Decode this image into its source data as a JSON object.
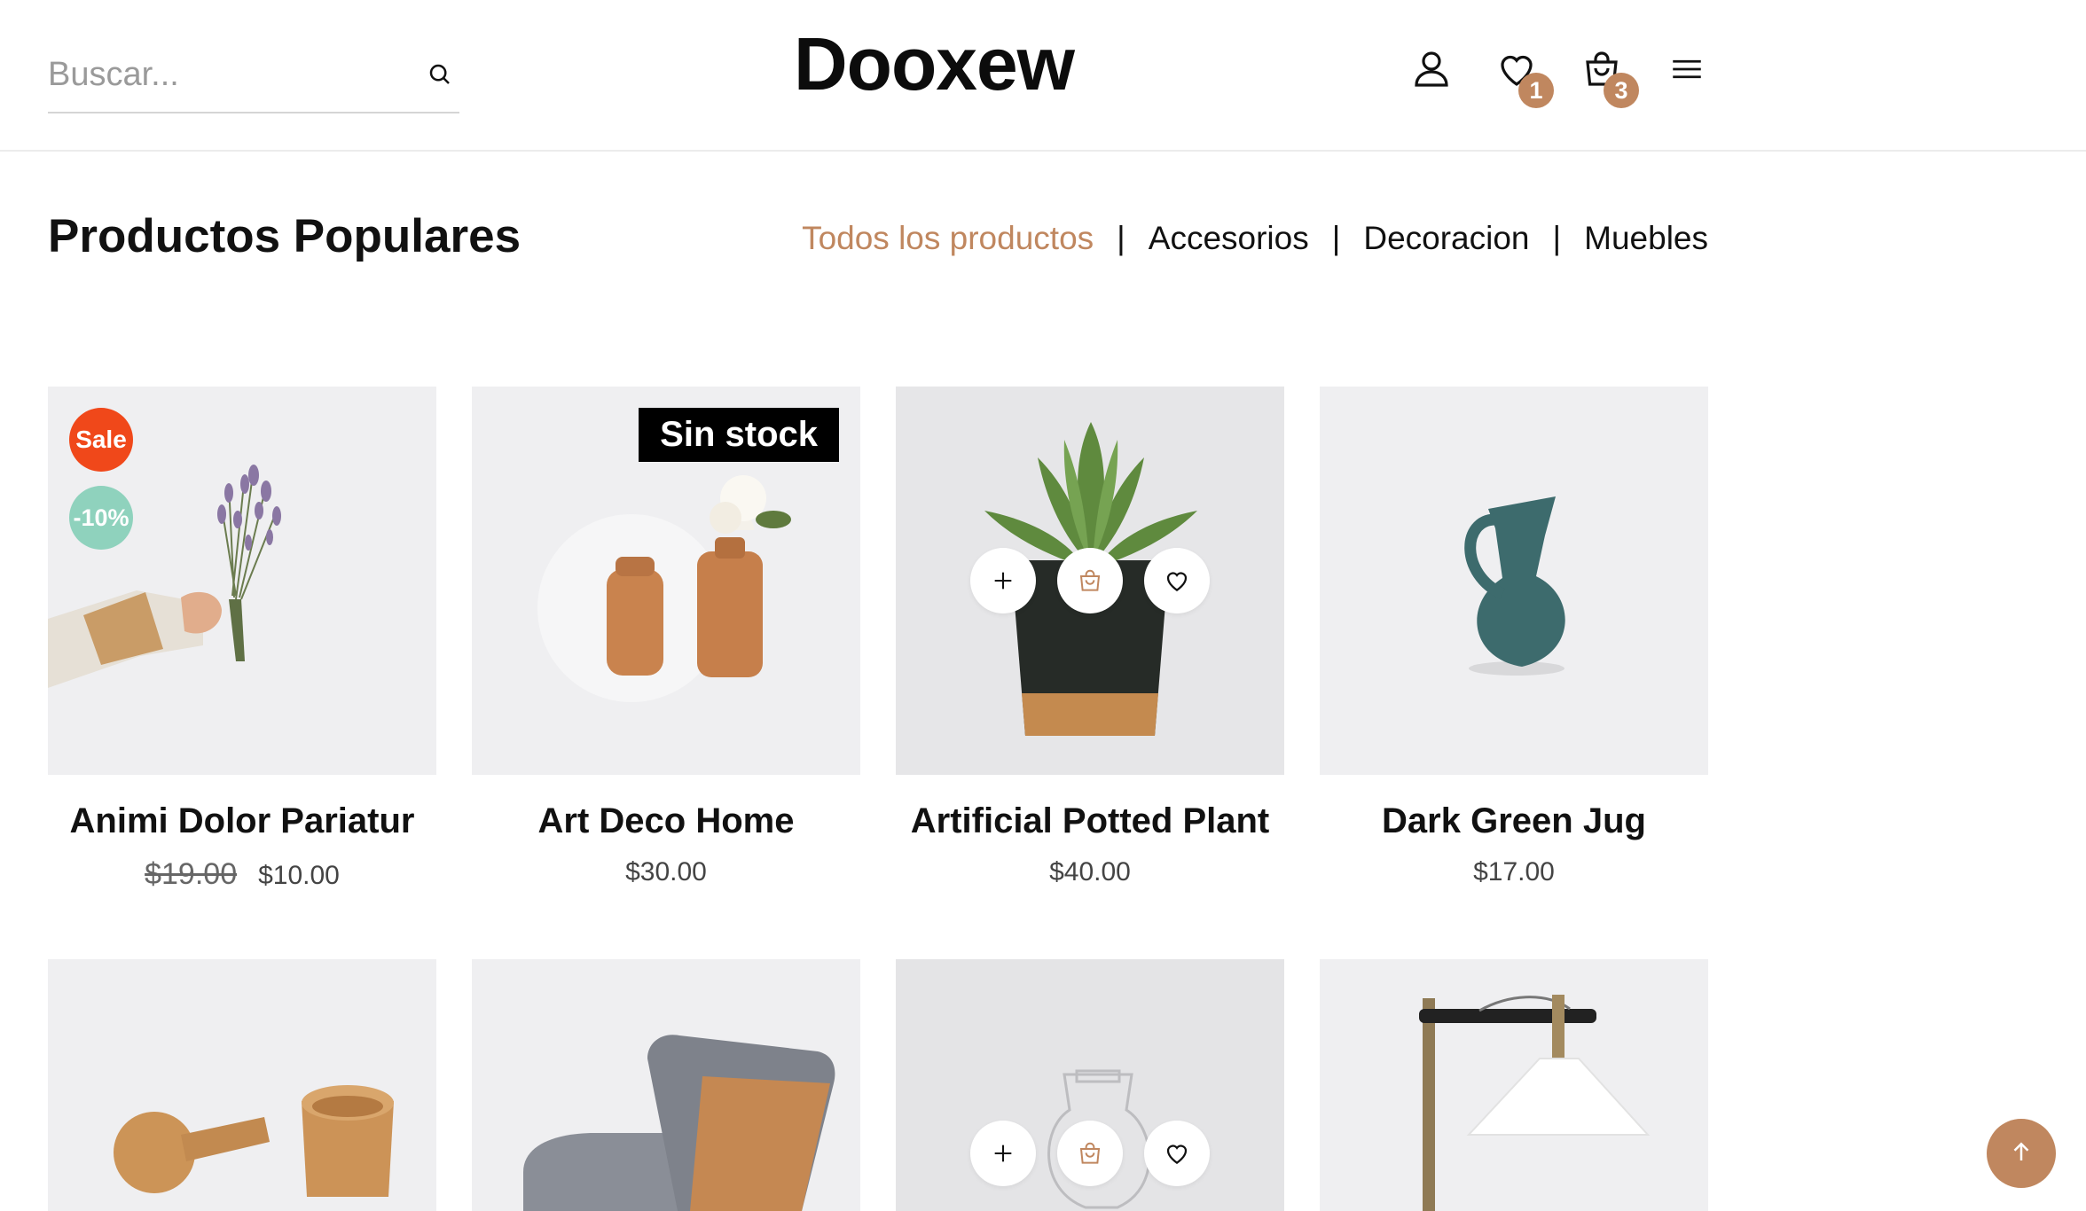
{
  "header": {
    "search": {
      "placeholder": "Buscar...",
      "icon": "search-icon"
    },
    "logo": "Dooxew",
    "wishlist_count": "1",
    "cart_count": "3"
  },
  "section": {
    "title": "Productos Populares",
    "filters": [
      "Todos los productos",
      "Accesorios",
      "Decoracion",
      "Muebles"
    ],
    "active_filter": "Todos los productos"
  },
  "products": [
    {
      "name": "Animi Dolor Pariatur",
      "old_price": "$19.00",
      "price": "$10.00",
      "sale_badge": "Sale",
      "discount_badge": "-10%"
    },
    {
      "name": "Art Deco Home",
      "price": "$30.00",
      "stock_badge": "Sin stock"
    },
    {
      "name": "Artificial Potted Plant",
      "price": "$40.00"
    },
    {
      "name": "Dark Green Jug",
      "price": "$17.00"
    }
  ],
  "colors": {
    "accent": "#c0875f",
    "sale": "#f0481a",
    "discount": "#8fd2bd",
    "card_bg": "#efeff1"
  }
}
